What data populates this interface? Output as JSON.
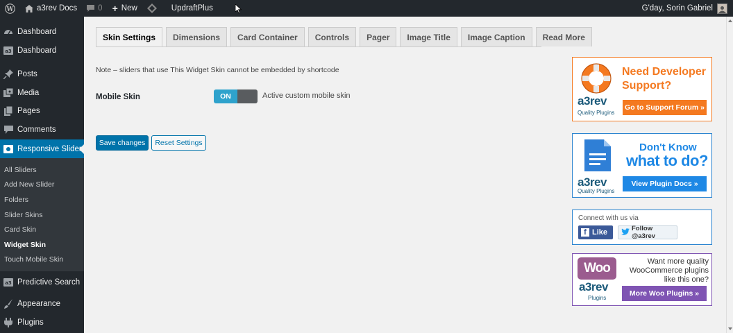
{
  "adminbar": {
    "site_name": "a3rev Docs",
    "comments_count": "0",
    "new_label": "New",
    "plugin_label": "UpdraftPlus",
    "greeting": "G'day, Sorin Gabriel"
  },
  "sidebar": {
    "items_top": [
      {
        "label": "Dashboard",
        "icon": "dashboard-icon"
      },
      {
        "label": "Dashboard",
        "icon": "a3-icon"
      },
      {
        "label": "Posts",
        "icon": "pin-icon"
      },
      {
        "label": "Media",
        "icon": "media-icon"
      },
      {
        "label": "Pages",
        "icon": "pages-icon"
      },
      {
        "label": "Comments",
        "icon": "comments-icon"
      }
    ],
    "current": {
      "label": "Responsive Slider",
      "icon": "slider-icon"
    },
    "submenu": [
      "All Sliders",
      "Add New Slider",
      "Folders",
      "Slider Skins",
      "Card Skin",
      "Widget Skin",
      "Touch Mobile Skin"
    ],
    "submenu_active_index": 5,
    "items_bottom": [
      {
        "label": "Predictive Search",
        "icon": "a3-icon"
      },
      {
        "label": "Appearance",
        "icon": "brush-icon"
      },
      {
        "label": "Plugins",
        "icon": "plugin-icon"
      }
    ]
  },
  "tabs": [
    "Skin Settings",
    "Dimensions",
    "Card Container",
    "Controls",
    "Pager",
    "Image Title",
    "Image Caption",
    "Read More"
  ],
  "active_tab_index": 0,
  "main": {
    "note": "Note – sliders that use This Widget Skin cannot be embedded by shortcode",
    "mobile_skin_label": "Mobile Skin",
    "toggle_state": "ON",
    "toggle_desc": "Active custom mobile skin",
    "save_label": "Save changes",
    "reset_label": "Reset Settings"
  },
  "panels": {
    "support": {
      "title_line1": "Need Developer",
      "title_line2": "Support?",
      "brand": "a3rev",
      "brand_sub": "Quality Plugins",
      "button": "Go to Support Forum »"
    },
    "docs": {
      "title_line1": "Don't Know",
      "title_line2": "what to do?",
      "brand": "a3rev",
      "brand_sub": "Quality Plugins",
      "button": "View Plugin Docs »"
    },
    "social": {
      "title": "Connect with us via",
      "fb_label": "Like",
      "tw_label": "Follow @a3rev"
    },
    "woo": {
      "logo_text": "Woo",
      "brand": "a3rev",
      "brand_sub": "Plugins",
      "text": "Want more quality WooCommerce plugins like this one?",
      "button": "More Woo Plugins »"
    }
  },
  "colors": {
    "admin_dark": "#23282d",
    "wp_blue": "#0073aa",
    "support_orange": "#f47920",
    "docs_blue": "#1e88e5",
    "woo_purple": "#7f54b3"
  }
}
